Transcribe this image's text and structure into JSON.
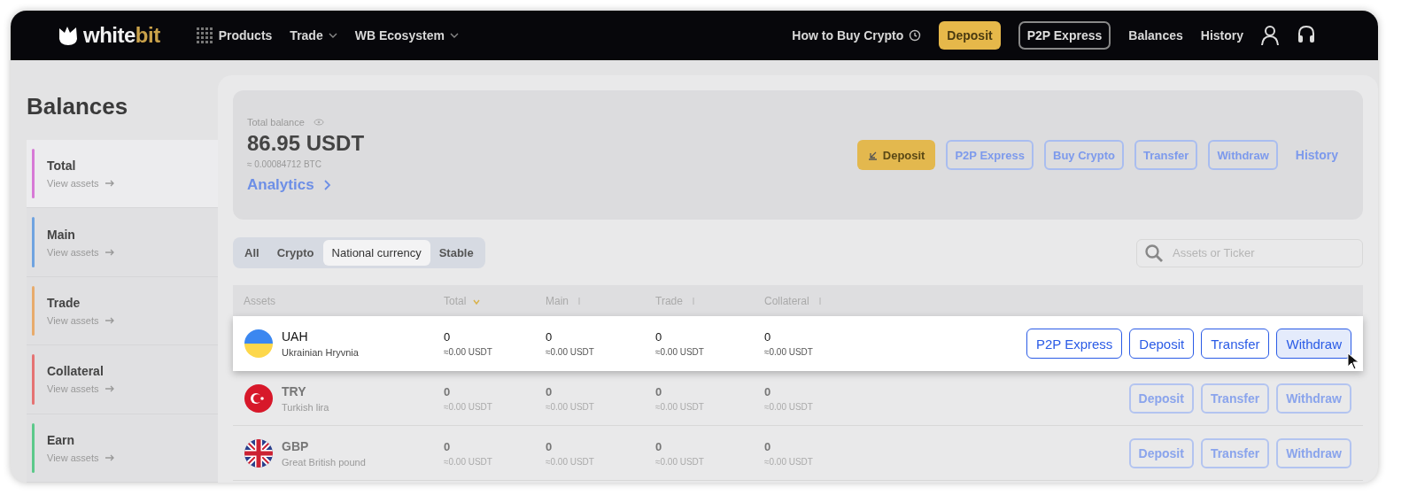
{
  "header": {
    "logo": [
      "white",
      "bit"
    ],
    "nav": [
      {
        "label": "Products",
        "kind": "apps"
      },
      {
        "label": "Trade",
        "kind": "menu"
      },
      {
        "label": "WB Ecosystem",
        "kind": "menu"
      }
    ],
    "right": [
      {
        "label": "How to Buy Crypto",
        "kind": "help"
      },
      {
        "label": "Deposit",
        "kind": "primary"
      },
      {
        "label": "P2P Express",
        "kind": "outline"
      },
      {
        "label": "Balances",
        "kind": "link"
      },
      {
        "label": "History",
        "kind": "link"
      }
    ]
  },
  "sidebar": {
    "title": "Balances",
    "items": [
      {
        "label": "Total",
        "sub": "View assets",
        "color": "#d77ad6",
        "selected": true
      },
      {
        "label": "Main",
        "sub": "View assets",
        "color": "#6fa3e0",
        "selected": false
      },
      {
        "label": "Trade",
        "sub": "View assets",
        "color": "#e8ab6c",
        "selected": false
      },
      {
        "label": "Collateral",
        "sub": "View assets",
        "color": "#e57373",
        "selected": false
      },
      {
        "label": "Earn",
        "sub": "View assets",
        "color": "#5cc98a",
        "selected": false
      }
    ]
  },
  "summary": {
    "label": "Total balance",
    "value": "86.95 USDT",
    "btc": "≈ 0.00084712 BTC",
    "link": "Analytics",
    "actions": [
      {
        "label": "Deposit",
        "kind": "primary"
      },
      {
        "label": "P2P Express",
        "kind": "outline"
      },
      {
        "label": "Buy Crypto",
        "kind": "outline"
      },
      {
        "label": "Transfer",
        "kind": "outline"
      },
      {
        "label": "Withdraw",
        "kind": "outline"
      },
      {
        "label": "History",
        "kind": "link"
      }
    ]
  },
  "filters": [
    {
      "label": "All",
      "selected": false
    },
    {
      "label": "Crypto",
      "selected": false
    },
    {
      "label": "National currency",
      "selected": true
    },
    {
      "label": "Stable",
      "selected": false
    }
  ],
  "search": {
    "placeholder": "Assets or Ticker"
  },
  "columns": [
    {
      "label": "Assets"
    },
    {
      "label": "Total",
      "sorted": true
    },
    {
      "label": "Main",
      "sorted": false
    },
    {
      "label": "Trade",
      "sorted": false
    },
    {
      "label": "Collateral",
      "sorted": false
    }
  ],
  "rows": [
    {
      "code": "UAH",
      "name": "Ukrainian Hryvnia",
      "cells": [
        [
          "0",
          "≈0.00 USDT"
        ],
        [
          "0",
          "≈0.00 USDT"
        ],
        [
          "0",
          "≈0.00 USDT"
        ],
        [
          "0",
          "≈0.00 USDT"
        ]
      ],
      "highlighted": true,
      "actions": [
        {
          "label": "P2P Express",
          "hovered": false
        },
        {
          "label": "Deposit",
          "hovered": false
        },
        {
          "label": "Transfer",
          "hovered": false
        },
        {
          "label": "Withdraw",
          "hovered": true
        }
      ]
    },
    {
      "code": "TRY",
      "name": "Turkish lira",
      "cells": [
        [
          "0",
          "≈0.00 USDT"
        ],
        [
          "0",
          "≈0.00 USDT"
        ],
        [
          "0",
          "≈0.00 USDT"
        ],
        [
          "0",
          "≈0.00 USDT"
        ]
      ],
      "highlighted": false,
      "actions": [
        {
          "label": "Deposit",
          "hovered": false
        },
        {
          "label": "Transfer",
          "hovered": false
        },
        {
          "label": "Withdraw",
          "hovered": false
        }
      ]
    },
    {
      "code": "GBP",
      "name": "Great British pound",
      "cells": [
        [
          "0",
          "≈0.00 USDT"
        ],
        [
          "0",
          "≈0.00 USDT"
        ],
        [
          "0",
          "≈0.00 USDT"
        ],
        [
          "0",
          "≈0.00 USDT"
        ]
      ],
      "highlighted": false,
      "actions": [
        {
          "label": "Deposit",
          "hovered": false
        },
        {
          "label": "Transfer",
          "hovered": false
        },
        {
          "label": "Withdraw",
          "hovered": false
        }
      ]
    }
  ]
}
